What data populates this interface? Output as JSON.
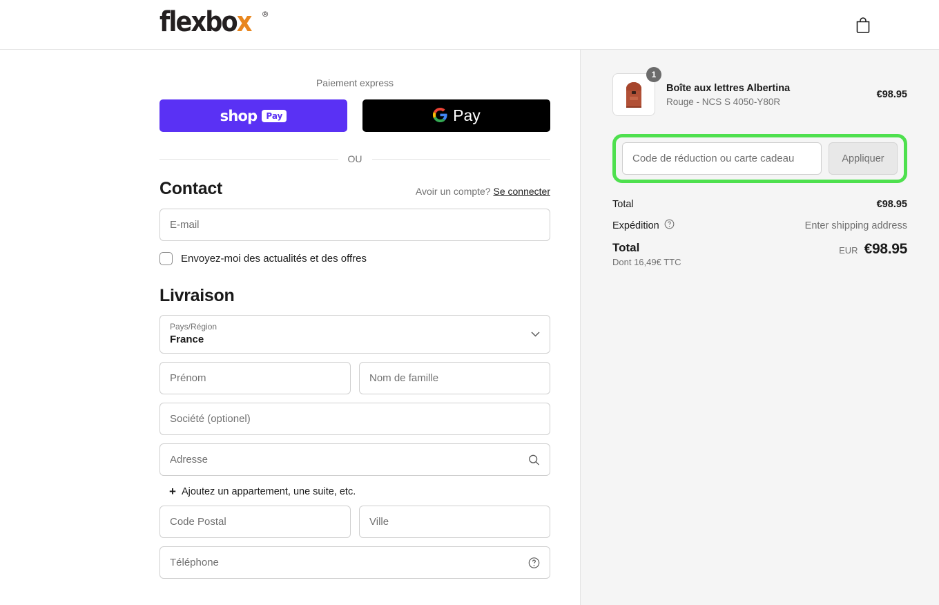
{
  "header": {
    "logo_main": "flexbo",
    "logo_x": "x",
    "logo_reg": "®",
    "cart_icon": "shopping-bag-icon"
  },
  "express": {
    "label": "Paiement express",
    "shop_pay_word": "shop",
    "shop_pay_pill": "Pay",
    "google_pay_word": "Pay",
    "or_text": "OU"
  },
  "contact": {
    "title": "Contact",
    "account_prompt": "Avoir un compte?",
    "login_link": "Se connecter",
    "email_placeholder": "E-mail",
    "newsletter_label": "Envoyez-moi des actualités et des offres"
  },
  "delivery": {
    "title": "Livraison",
    "country_label": "Pays/Région",
    "country_value": "France",
    "first_name_placeholder": "Prénom",
    "last_name_placeholder": "Nom de famille",
    "company_placeholder": "Société (optionel)",
    "address_placeholder": "Adresse",
    "address_icon": "search-icon",
    "add_apartment": "Ajoutez un appartement, une suite, etc.",
    "add_apartment_plus": "+",
    "postal_placeholder": "Code Postal",
    "city_placeholder": "Ville",
    "phone_placeholder": "Téléphone",
    "phone_icon": "help-circle-icon"
  },
  "summary": {
    "item": {
      "title": "Boîte aux lettres Albertina",
      "variant": "Rouge - NCS S 4050-Y80R",
      "price": "€98.95",
      "quantity": "1",
      "image": "mailbox-thumbnail"
    },
    "discount": {
      "placeholder": "Code de réduction ou carte cadeau",
      "apply_label": "Appliquer",
      "highlight_color": "#4ee04e"
    },
    "subtotal_label": "Total",
    "subtotal_value": "€98.95",
    "shipping_label": "Expédition",
    "shipping_info_icon": "help-circle-icon",
    "shipping_value": "Enter shipping address",
    "total_label": "Total",
    "total_tax_note": "Dont 16,49€ TTC",
    "total_currency": "EUR",
    "total_value": "€98.95"
  },
  "colors": {
    "shop_pay": "#5a31f4",
    "google_pay": "#000000",
    "accent_orange": "#e8861e",
    "sidebar_bg": "#f5f5f5"
  }
}
